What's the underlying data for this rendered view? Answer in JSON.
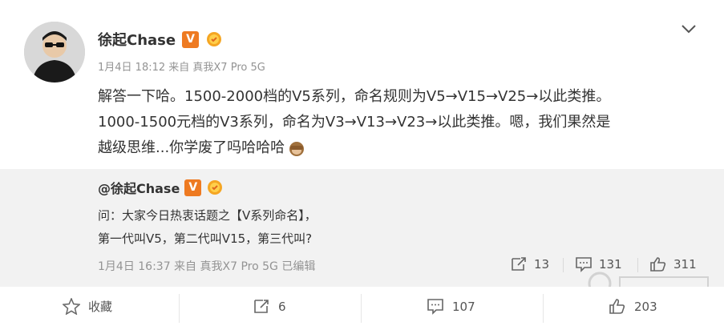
{
  "post": {
    "author": "徐起Chase",
    "verified_badge": "V",
    "meta": "1月4日 18:12 来自 真我X7 Pro 5G",
    "text_line1": "解答一下哈。1500-2000档的V5系列，命名规则为V5→V15→V25→以此类推。",
    "text_line2": "1000-1500元档的V3系列，命名为V3→V13→V23→以此类推。嗯，我们果然是",
    "text_line3": "越级思维...你学废了吗哈哈哈"
  },
  "quoted": {
    "author": "@徐起Chase",
    "verified_badge": "V",
    "line1": "问：大家今日热衷话题之【V系列命名】，",
    "line2": "第一代叫V5，第二代叫V15，第三代叫?",
    "meta": "1月4日 16:37 来自 真我X7 Pro 5G  已编辑",
    "reposts": "13",
    "comments": "131",
    "likes": "311"
  },
  "actions": {
    "favorite_label": "收藏",
    "repost_count": "6",
    "comment_count": "107",
    "like_count": "203"
  },
  "colors": {
    "badge_orange": "#ee7a21",
    "quote_bg": "#f2f2f2",
    "meta_gray": "#939393"
  },
  "icons": [
    "chevron-down-icon",
    "verified-v-icon",
    "medal-icon",
    "see-no-evil-monkey-icon",
    "repost-icon",
    "comment-icon",
    "like-icon",
    "star-icon"
  ]
}
